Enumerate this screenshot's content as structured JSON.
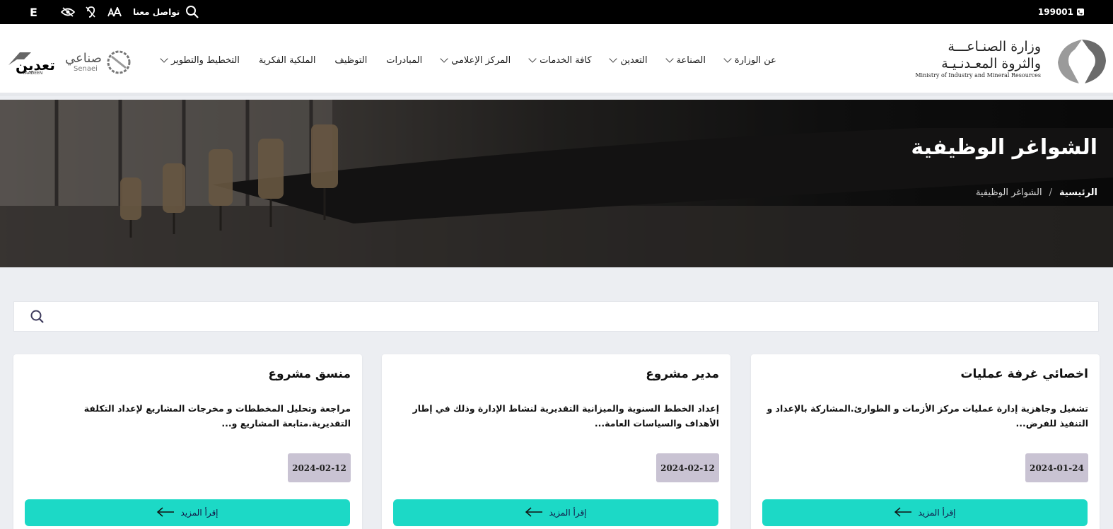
{
  "topbar": {
    "phone": "199001",
    "lang": "E",
    "contact": "تواصل معنا"
  },
  "logo": {
    "line1": "وزارة الصنـاعـــة",
    "line2": "والثروة المعـدنـيـة",
    "line3": "Ministry of Industry and Mineral Resources",
    "senaei_ar": "صناعي",
    "senaei_en": "Senaei",
    "taadeen_ar": "تعدين",
    "taadeen_en": "TAADEEN"
  },
  "nav": {
    "items": [
      {
        "label": "عن الوزارة",
        "dropdown": true
      },
      {
        "label": "الصناعة",
        "dropdown": true
      },
      {
        "label": "التعدين",
        "dropdown": true
      },
      {
        "label": "كافة الخدمات",
        "dropdown": true
      },
      {
        "label": "المركز الإعلامي",
        "dropdown": true
      },
      {
        "label": "المبادرات",
        "dropdown": false
      },
      {
        "label": "التوظيف",
        "dropdown": false
      },
      {
        "label": "الملكية الفكرية",
        "dropdown": false
      },
      {
        "label": "التخطيط والتطوير",
        "dropdown": true
      }
    ]
  },
  "hero": {
    "title": "الشواغر الوظيفية",
    "breadcrumb_home": "الرئيسية",
    "breadcrumb_sep": "/",
    "breadcrumb_current": "الشواغر الوظيفية"
  },
  "search": {
    "value": "",
    "placeholder": ""
  },
  "cards": [
    {
      "title": "اخصائي غرفة عمليات",
      "description": "تشغيل وجاهزية إدارة عمليات مركز الأزمات و الطوارئ.المشاركة بالإعداد و التنفيذ للفرض...",
      "date": "2024-01-24",
      "button": "إقرأ المزيد"
    },
    {
      "title": "مدير مشروع",
      "description": "إعداد الخطط السنوية والميزانية التقديرية لنشاط الإدارة وذلك في إطار الأهداف والسياسات العامة...",
      "date": "2024-02-12",
      "button": "إقرأ المزيد"
    },
    {
      "title": "منسق مشروع",
      "description": "مراجعة وتحليل المخططات و مخرجات المشاريع لإعداد التكلفة التقديرية.متابعة المشاريع و...",
      "date": "2024-02-12",
      "button": "إقرأ المزيد"
    }
  ],
  "colors": {
    "topbar_bg": "#000000",
    "accent_button": "#1cd9c6",
    "date_badge": "#c9c3d3",
    "page_bg": "#eceef2"
  }
}
